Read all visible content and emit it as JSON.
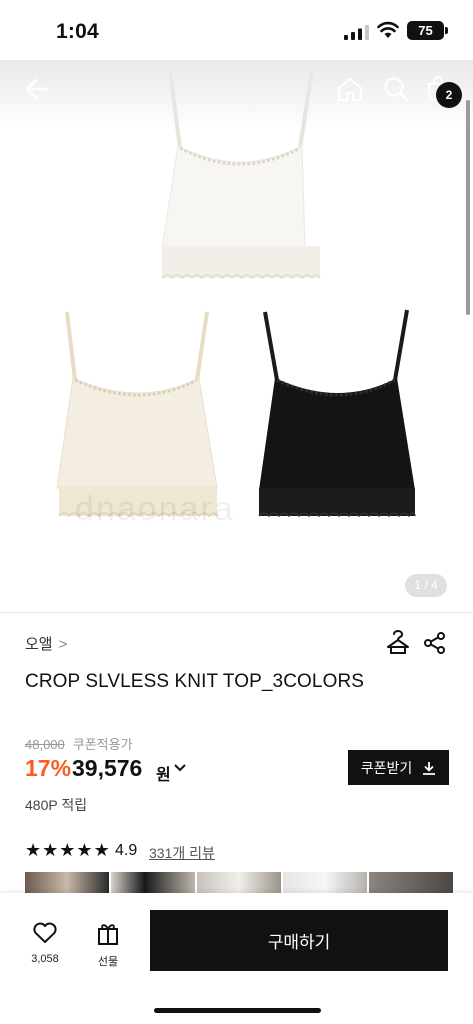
{
  "status_bar": {
    "time": "1:04",
    "battery": "75"
  },
  "hero": {
    "cart_count": "2",
    "image_counter": "1 / 4",
    "watermark": "dnaonara"
  },
  "product": {
    "brand": "오앨",
    "brand_chevron": ">",
    "title": "CROP SLVLESS KNIT TOP_3COLORS",
    "original_price": "48,000",
    "coupon_label": "쿠폰적용가",
    "discount": "17%",
    "price": "39,576",
    "currency": "원",
    "coupon_button": "쿠폰받기",
    "points": "480P 적립",
    "rating": "4.9",
    "reviews": "331개 리뷰",
    "colors": [
      "#f7f5f1",
      "#f4eee2",
      "#141414"
    ]
  },
  "bottom_bar": {
    "likes": "3,058",
    "gift_label": "선물",
    "buy_label": "구매하기"
  },
  "icons": [
    "back-arrow-icon",
    "home-icon",
    "search-icon",
    "cart-icon",
    "hanger-icon",
    "share-icon",
    "heart-icon",
    "gift-icon",
    "download-icon",
    "star-icon",
    "chevron-down-icon"
  ]
}
